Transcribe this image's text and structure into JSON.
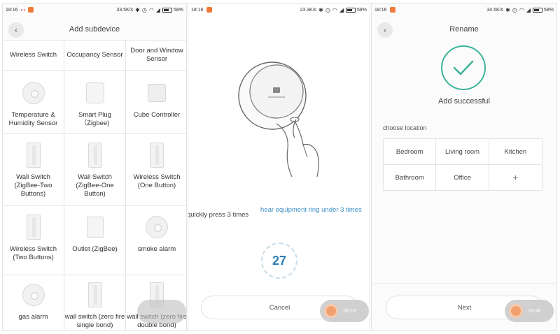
{
  "screens": [
    {
      "status": {
        "time": "18:16",
        "dots": "••",
        "net": "33.5K/s",
        "battery": "58%"
      },
      "title": "Add subdevice",
      "rows": [
        [
          "Wireless Switch",
          "Occupancy Sensor",
          "Door and Window Sensor"
        ],
        [
          "Temperature & Humidity Sensor",
          "Smart Plug（Zigbee)",
          "Cube Controller"
        ],
        [
          "Wall Switch (ZigBee-Two Buttons)",
          "Wall Switch (ZigBee-One Button)",
          "Wireless Switch (One Button)"
        ],
        [
          "Wireless Switch (Two Buttons)",
          "Outlet (ZigBee)",
          "smoke alarm"
        ],
        [
          "gas alarm",
          "wall switch (zero fire single bond)",
          "wall switch (zero fire double bond)"
        ]
      ],
      "icons": [
        [
          null,
          null,
          null
        ],
        [
          "round-sensor-icon",
          "smart-plug-icon",
          "cube-icon"
        ],
        [
          "wall-switch-icon",
          "wall-switch-icon",
          "wall-switch-icon"
        ],
        [
          "wall-switch-icon",
          "outlet-icon",
          "smoke-alarm-icon"
        ],
        [
          "gas-alarm-icon",
          "wall-switch-icon",
          "wall-switch-icon"
        ]
      ]
    },
    {
      "status": {
        "time": "18:16",
        "net": "23.3K/s",
        "battery": "58%"
      },
      "instruction": "quickly press 3 times",
      "hint": "hear equipment ring under 3 times",
      "countdown": "27",
      "cancel_label": "Cancel",
      "recording_time": "00:15"
    },
    {
      "status": {
        "time": "18:16",
        "net": "34.5K/s",
        "battery": "58%"
      },
      "title": "Rename",
      "success": "Add successful",
      "location_label": "choose location",
      "locations": [
        [
          "Bedroom",
          "Living room",
          "Kitchen"
        ],
        [
          "Bathroom",
          "Office",
          "+"
        ]
      ],
      "next_label": "Next",
      "recording_time": "00:40"
    }
  ],
  "colors": {
    "accent_blue": "#3a8ec6",
    "success_green": "#3bb39a",
    "record_orange": "#f2a070"
  },
  "status_icons": [
    "bluetooth-icon",
    "alarm-icon",
    "wifi-icon",
    "signal-icon",
    "battery-icon"
  ]
}
